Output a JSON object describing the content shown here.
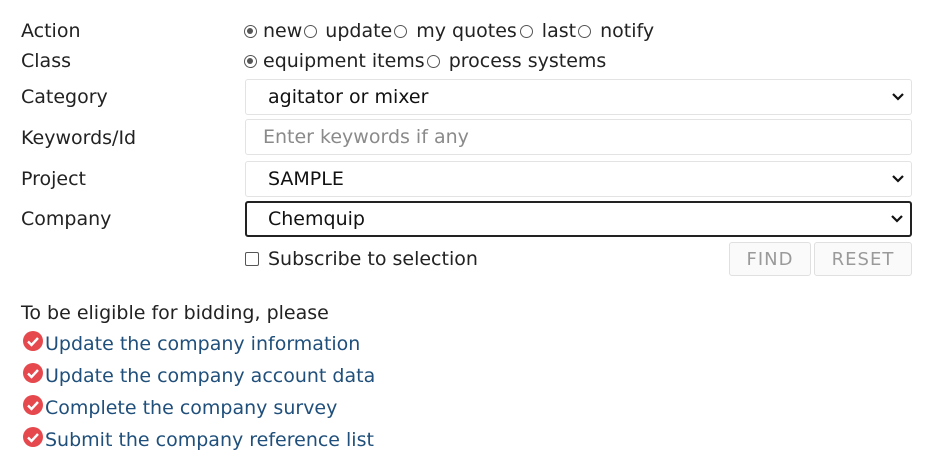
{
  "form": {
    "action": {
      "label": "Action",
      "options": [
        {
          "label": "new",
          "selected": true
        },
        {
          "label": "update",
          "selected": false
        },
        {
          "label": "my quotes",
          "selected": false
        },
        {
          "label": "last",
          "selected": false
        },
        {
          "label": "notify",
          "selected": false
        }
      ]
    },
    "class": {
      "label": "Class",
      "options": [
        {
          "label": "equipment items",
          "selected": true
        },
        {
          "label": "process systems",
          "selected": false
        }
      ]
    },
    "category": {
      "label": "Category",
      "value": "agitator or mixer"
    },
    "keywords": {
      "label": "Keywords/Id",
      "placeholder": "Enter keywords if any",
      "value": ""
    },
    "project": {
      "label": "Project",
      "value": "SAMPLE"
    },
    "company": {
      "label": "Company",
      "value": "Chemquip"
    },
    "subscribe": {
      "label": "Subscribe to selection",
      "checked": false
    },
    "find_label": "FIND",
    "reset_label": "RESET"
  },
  "eligibility": {
    "intro": "To be eligible for bidding, please",
    "links": [
      "Update the company information",
      "Update the company account data",
      "Complete the company survey",
      "Submit the company reference list"
    ]
  },
  "colors": {
    "link": "#1f4f7a",
    "check_badge": "#e5484d",
    "text": "#222222"
  }
}
